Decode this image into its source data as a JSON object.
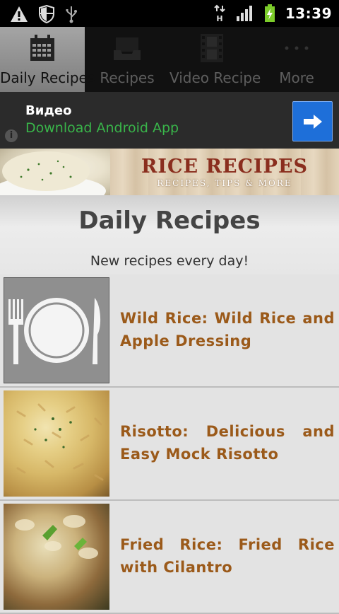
{
  "status_bar": {
    "time": "13:39",
    "icons": [
      "warning-icon",
      "shield-icon",
      "usb-icon",
      "hsdpa-icon",
      "signal-icon",
      "battery-charging-icon"
    ]
  },
  "tabs": [
    {
      "label": "Daily Recipes",
      "icon": "calendar-icon",
      "active": true
    },
    {
      "label": "Recipes",
      "icon": "inbox-icon",
      "active": false
    },
    {
      "label": "Video Recipe",
      "icon": "film-icon",
      "active": false
    },
    {
      "label": "More",
      "icon": "more-dots-icon",
      "active": false
    }
  ],
  "ad": {
    "title": "Видео",
    "subtitle": "Download Android App",
    "info_label": "i",
    "colors": {
      "subtitle": "#39b54a",
      "button": "#1e6fd9"
    }
  },
  "banner": {
    "title": "RICE RECIPES",
    "subtitle": "RECIPES, TIPS & MORE"
  },
  "header": {
    "title": "Daily Recipes",
    "subtitle": "New recipes every day!"
  },
  "recipes": [
    {
      "title": "Wild Rice: Wild Rice and Apple Dressing",
      "image": "plate-placeholder-icon"
    },
    {
      "title": "Risotto: Delicious and Easy Mock Risotto",
      "image": "risotto-photo"
    },
    {
      "title": "Fried Rice: Fried Rice with Cilantro",
      "image": "fried-rice-photo"
    }
  ],
  "colors": {
    "recipe_title": "#9b5a1a",
    "banner_title": "#8a2e1e"
  }
}
